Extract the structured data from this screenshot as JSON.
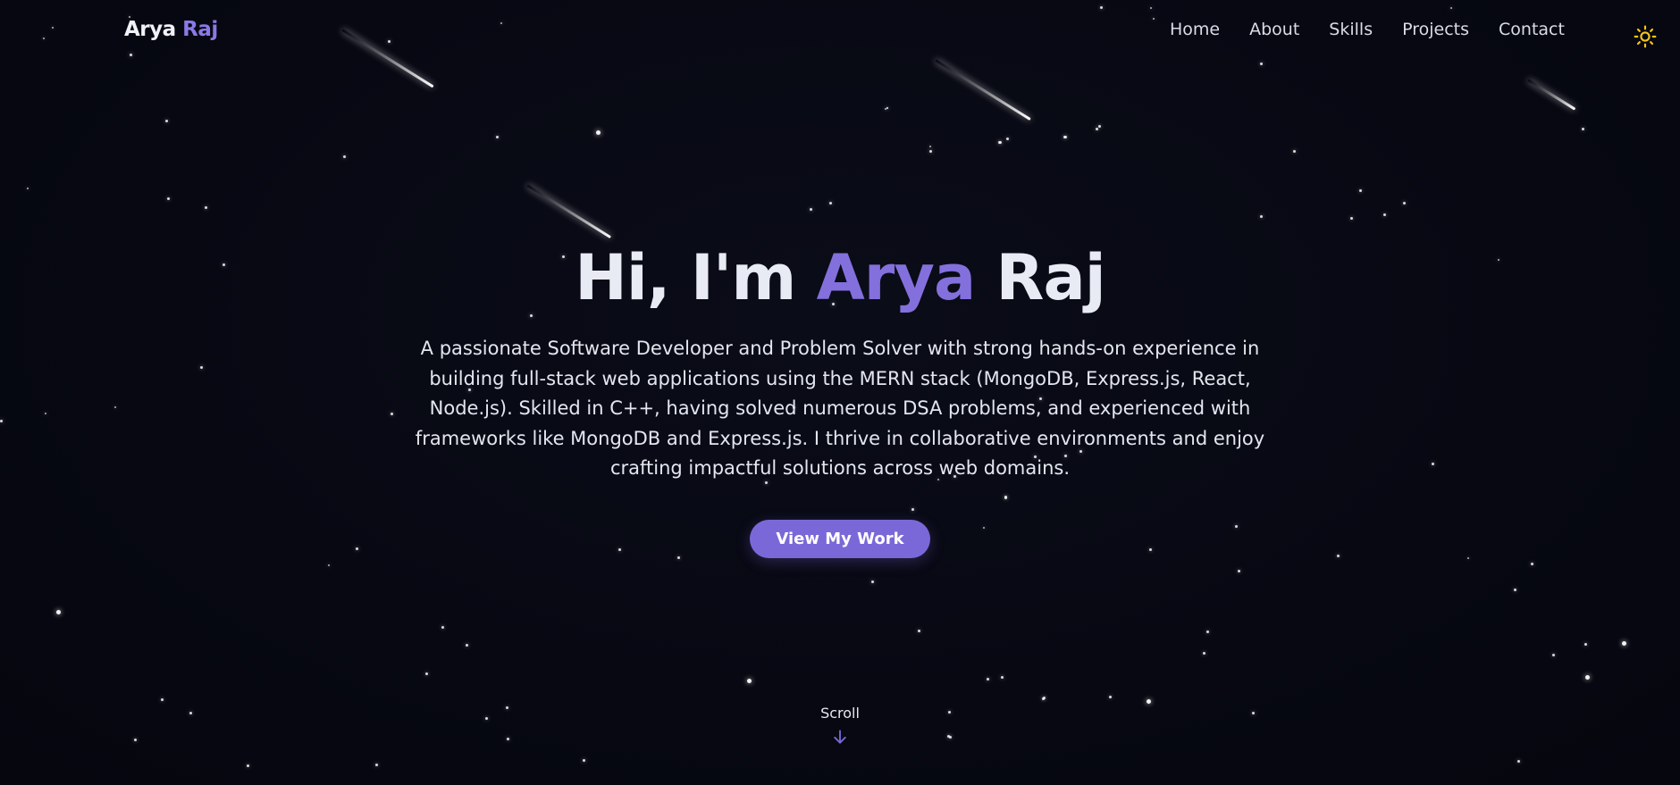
{
  "header": {
    "logo_first": "Arya",
    "logo_second": "Raj",
    "nav": [
      "Home",
      "About",
      "Skills",
      "Projects",
      "Contact"
    ],
    "theme_icon": "sun-icon"
  },
  "hero": {
    "greeting": "Hi, I'm ",
    "name_first": "Arya",
    "name_last": " Raj",
    "description": "A passionate Software Developer and Problem Solver with strong hands-on experience in building full-stack web applications using the MERN stack (MongoDB, Express.js, React, Node.js). Skilled in C++, having solved numerous DSA problems, and experienced with frameworks like MongoDB and Express.js. I thrive in collaborative environments and enjoy crafting impactful solutions across web domains.",
    "cta_label": "View My Work"
  },
  "scroll": {
    "label": "Scroll",
    "icon": "arrow-down-icon"
  },
  "colors": {
    "background": "#070812",
    "accent": "#7b68d8",
    "sun": "#f5c518"
  }
}
